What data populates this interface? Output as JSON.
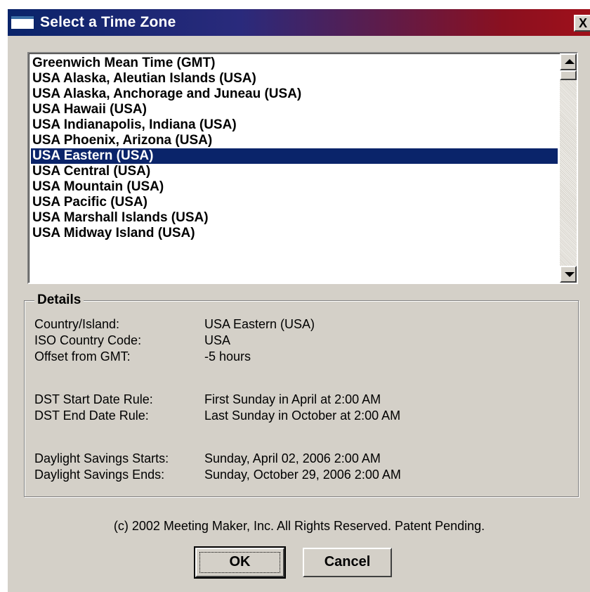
{
  "window": {
    "title": "Select a Time Zone",
    "close_label": "X"
  },
  "time_zones": {
    "items": [
      "Greenwich Mean Time (GMT)",
      "USA Alaska, Aleutian Islands (USA)",
      "USA Alaska, Anchorage and Juneau (USA)",
      "USA Hawaii (USA)",
      "USA Indianapolis, Indiana (USA)",
      "USA Phoenix, Arizona (USA)",
      "USA Eastern (USA)",
      "USA Central (USA)",
      "USA Mountain (USA)",
      "USA Pacific (USA)",
      "USA Marshall Islands (USA)",
      "USA Midway Island (USA)"
    ],
    "selected": "USA Eastern (USA)"
  },
  "details": {
    "legend": "Details",
    "country_label": "Country/Island:",
    "country_value": "USA Eastern (USA)",
    "iso_label": "ISO Country Code:",
    "iso_value": "USA",
    "offset_label": "Offset from GMT:",
    "offset_value": "-5 hours",
    "dst_start_rule_label": "DST Start Date Rule:",
    "dst_start_rule_value": "First Sunday in April at  2:00 AM",
    "dst_end_rule_label": "DST End Date Rule:",
    "dst_end_rule_value": "Last Sunday in October at  2:00 AM",
    "ds_starts_label": "Daylight Savings Starts:",
    "ds_starts_value": "Sunday, April 02, 2006  2:00 AM",
    "ds_ends_label": "Daylight Savings Ends:",
    "ds_ends_value": "Sunday, October 29, 2006  2:00 AM"
  },
  "copyright": "(c) 2002 Meeting Maker, Inc. All Rights Reserved. Patent Pending.",
  "buttons": {
    "ok": "OK",
    "cancel": "Cancel"
  },
  "colors": {
    "selection": "#0a246a",
    "dialog_face": "#d4d0c8"
  }
}
